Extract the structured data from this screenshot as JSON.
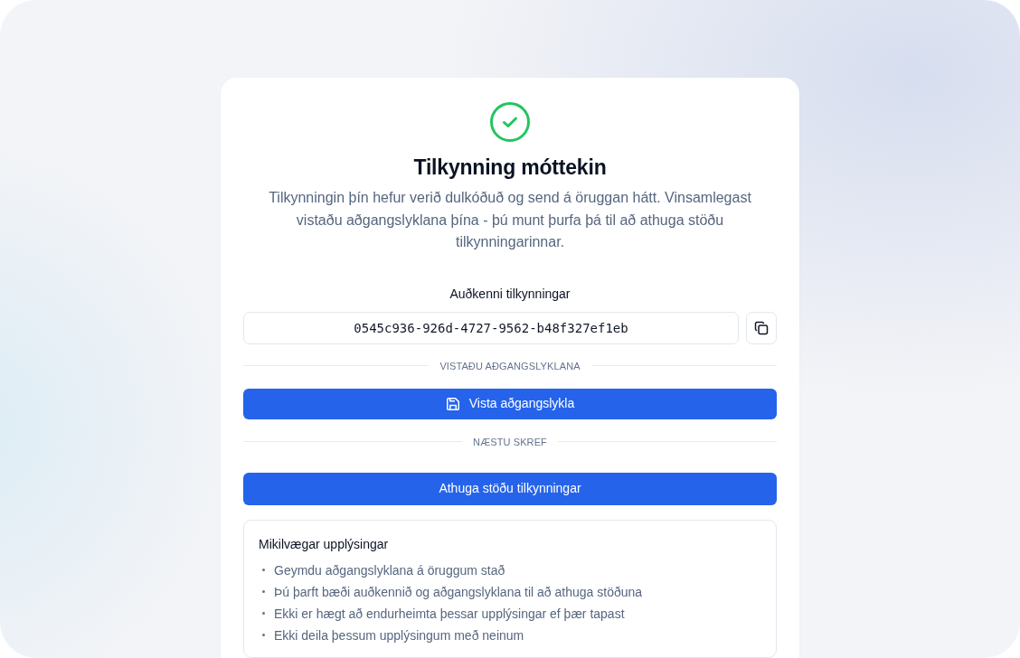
{
  "header": {
    "title": "Tilkynning móttekin",
    "message": "Tilkynningin þín hefur verið dulkóðuð og send á öruggan hátt. Vinsamlegast vistaðu aðgangslyklana þína - þú munt þurfa þá til að athuga stöðu tilkynningarinnar."
  },
  "report_id": {
    "label": "Auðkenni tilkynningar",
    "value": "0545c936-926d-4727-9562-b48f327ef1eb"
  },
  "save_keys": {
    "divider": "VISTAÐU AÐGANGSLYKLANA",
    "button": "Vista aðgangslykla"
  },
  "next_steps": {
    "divider": "NÆSTU SKREF",
    "button": "Athuga stöðu tilkynningar"
  },
  "info": {
    "title": "Mikilvægar upplýsingar",
    "items": [
      "Geymdu aðgangslyklana á öruggum stað",
      "Þú þarft bæði auðkennið og aðgangslyklana til að athuga stöðuna",
      "Ekki er hægt að endurheimta þessar upplýsingar ef þær tapast",
      "Ekki deila þessum upplýsingum með neinum"
    ]
  }
}
